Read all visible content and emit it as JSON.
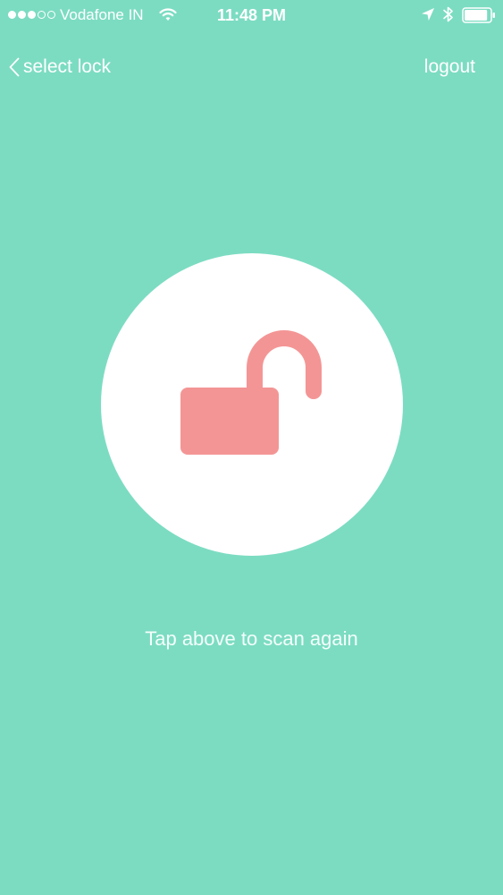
{
  "status_bar": {
    "carrier": "Vodafone IN",
    "time": "11:48 PM",
    "signal_bars_filled": 3,
    "signal_bars_total": 5,
    "battery_level": 0.9,
    "icons": [
      "wifi-icon",
      "location-arrow-icon",
      "bluetooth-icon",
      "battery-icon"
    ]
  },
  "nav": {
    "back_label": "select lock",
    "logout_label": "logout"
  },
  "scan": {
    "icon": "unlocked-padlock-icon",
    "hint": "Tap above to scan again"
  },
  "colors": {
    "background": "#7cdcc2",
    "circle": "#ffffff",
    "lock": "#f49595",
    "text": "#ffffff"
  }
}
